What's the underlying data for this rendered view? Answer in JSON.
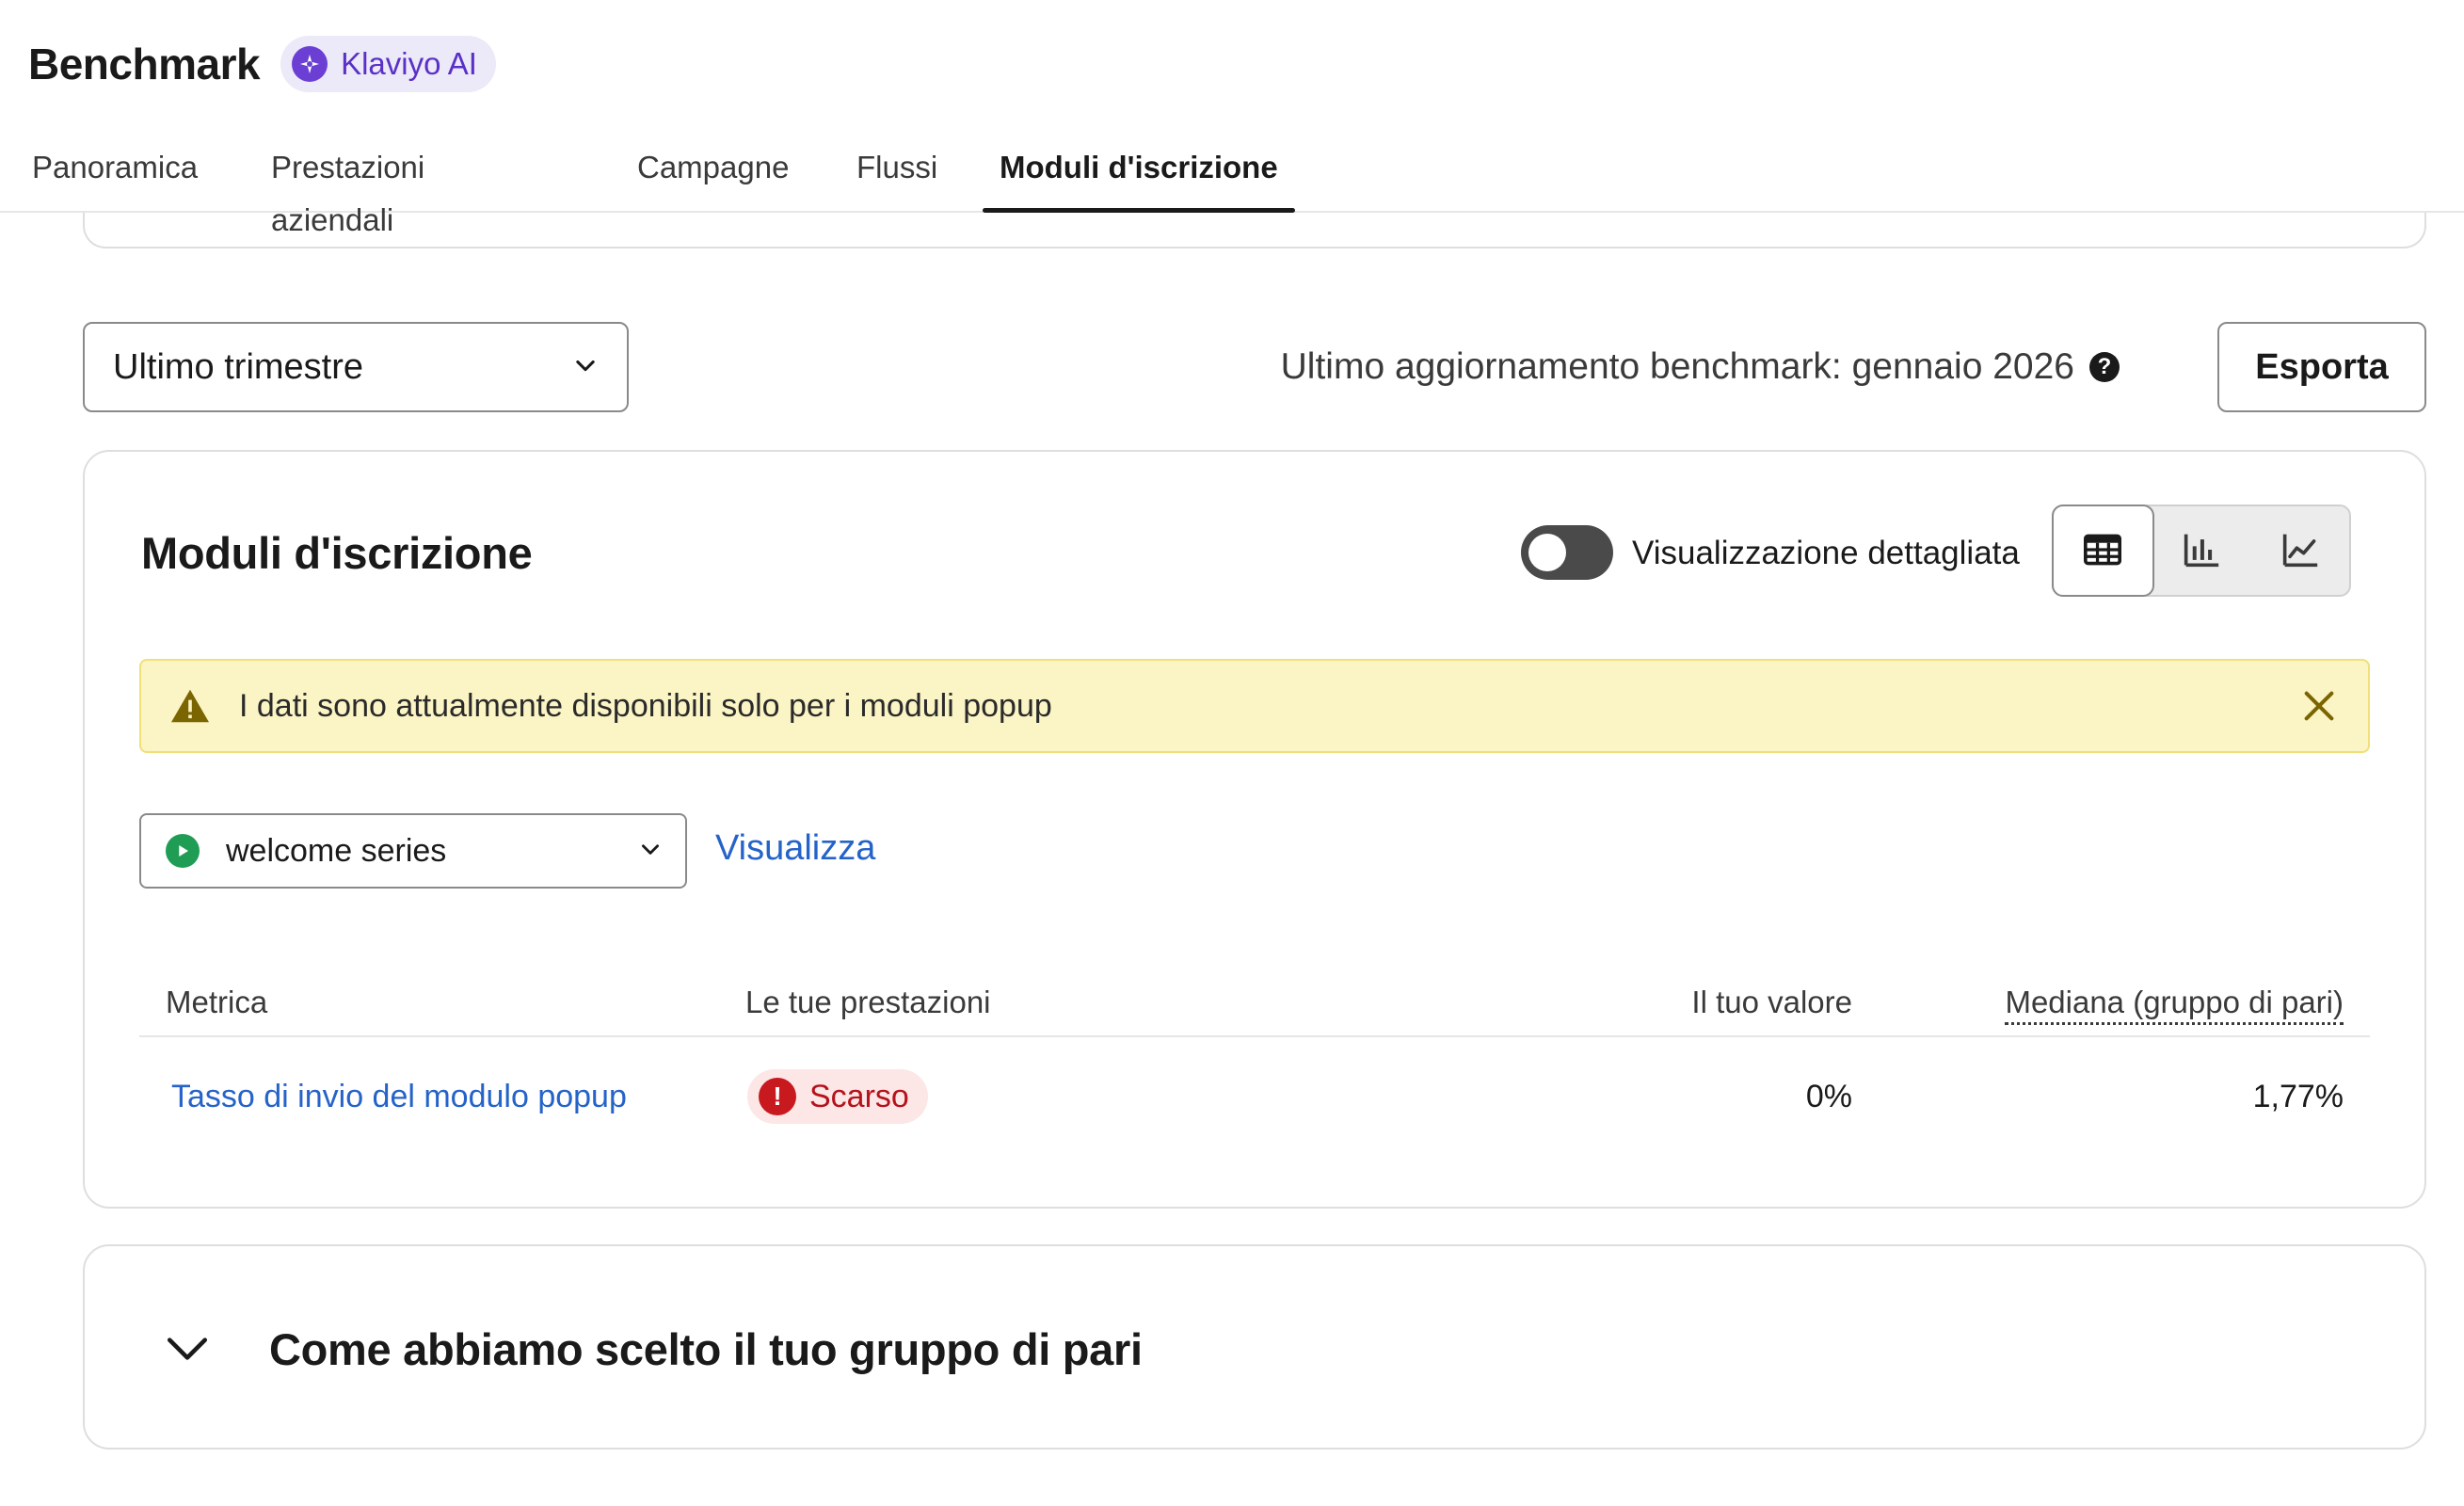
{
  "header": {
    "title": "Benchmark",
    "ai_badge": "Klaviyo AI",
    "tabs": [
      {
        "label": "Panoramica",
        "active": false
      },
      {
        "label": "Prestazioni aziendali",
        "active": false
      },
      {
        "label": "Campagne",
        "active": false
      },
      {
        "label": "Flussi",
        "active": false
      },
      {
        "label": "Moduli d'iscrizione",
        "active": true
      }
    ]
  },
  "controls": {
    "period_value": "Ultimo trimestre",
    "update_text": "Ultimo aggiornamento benchmark: gennaio 2026",
    "export_label": "Esporta"
  },
  "card": {
    "title": "Moduli d'iscrizione",
    "toggle_label": "Visualizzazione dettagliata",
    "toggle_on": false,
    "view_modes": [
      "table-icon",
      "bar-chart-icon",
      "line-chart-icon"
    ],
    "active_view": "table-icon",
    "alert_text": "I dati sono attualmente disponibili solo per i moduli popup",
    "form_select_value": "welcome series",
    "view_link": "Visualizza",
    "table": {
      "headers": {
        "metric": "Metrica",
        "performance": "Le tue prestazioni",
        "value": "Il tuo valore",
        "median": "Mediana (gruppo di pari)"
      },
      "rows": [
        {
          "metric": "Tasso di invio del modulo popup",
          "performance": "Scarso",
          "value": "0%",
          "median": "1,77%"
        }
      ]
    }
  },
  "accordion": {
    "title": "Come abbiamo scelto il tuo gruppo di pari"
  },
  "colors": {
    "accent_link": "#2563c9",
    "ai_purple": "#6b3fd4",
    "alert_bg": "#fbf4c4",
    "poor_red": "#c8191e",
    "active_green": "#1f9d55"
  }
}
